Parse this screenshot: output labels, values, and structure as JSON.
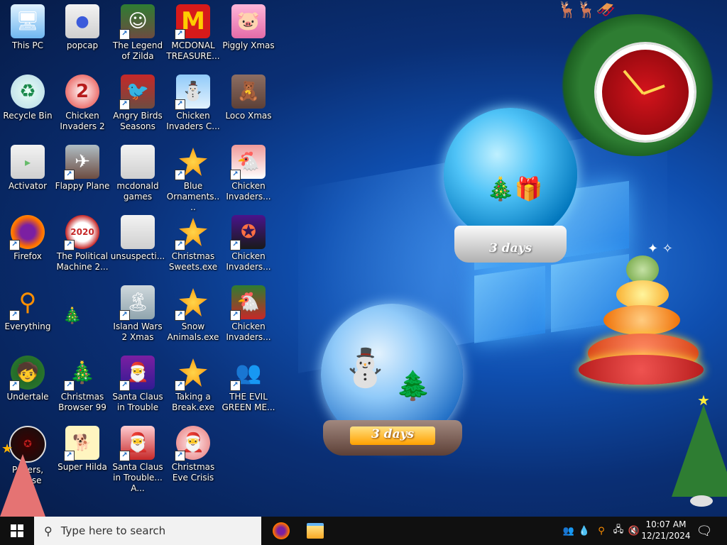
{
  "desktop": {
    "icons": [
      {
        "label": "This PC"
      },
      {
        "label": "popcap"
      },
      {
        "label": "The Legend of Zilda"
      },
      {
        "label": "MCDONAL TREASURE..."
      },
      {
        "label": "Piggly Xmas"
      },
      {
        "label": "Recycle Bin"
      },
      {
        "label": "Chicken Invaders 2"
      },
      {
        "label": "Angry Birds Seasons"
      },
      {
        "label": "Chicken Invaders C..."
      },
      {
        "label": "Loco Xmas"
      },
      {
        "label": "Activator"
      },
      {
        "label": "Flappy Plane"
      },
      {
        "label": "mcdonald games"
      },
      {
        "label": "Blue Ornaments...."
      },
      {
        "label": "Chicken Invaders..."
      },
      {
        "label": "Firefox"
      },
      {
        "label": "The Political Machine 2..."
      },
      {
        "label": "unsuspecti..."
      },
      {
        "label": "Christmas Sweets.exe"
      },
      {
        "label": "Chicken Invaders..."
      },
      {
        "label": "Everything"
      },
      {
        "label": "Island Wars 2 Xmas"
      },
      {
        "label": "Snow Animals.exe"
      },
      {
        "label": "Chicken Invaders..."
      },
      {
        "label": "Undertale"
      },
      {
        "label": "Christmas Browser 99"
      },
      {
        "label": "Santa Claus in Trouble"
      },
      {
        "label": "Taking a Break.exe"
      },
      {
        "label": "THE EVIL GREEN ME..."
      },
      {
        "label": "Papers, Please"
      },
      {
        "label": "Super Hilda"
      },
      {
        "label": "Santa Claus in Trouble... A..."
      },
      {
        "label": "Christmas Eve Crisis"
      }
    ],
    "globe_top_label": "3 days",
    "globe_bottom_label": "3 days"
  },
  "taskbar": {
    "search_placeholder": "Type here to search",
    "time": "10:07 AM",
    "date": "12/21/2024"
  },
  "colors": {
    "taskbar": "#101010",
    "wallpaper": "#0a2f75"
  }
}
